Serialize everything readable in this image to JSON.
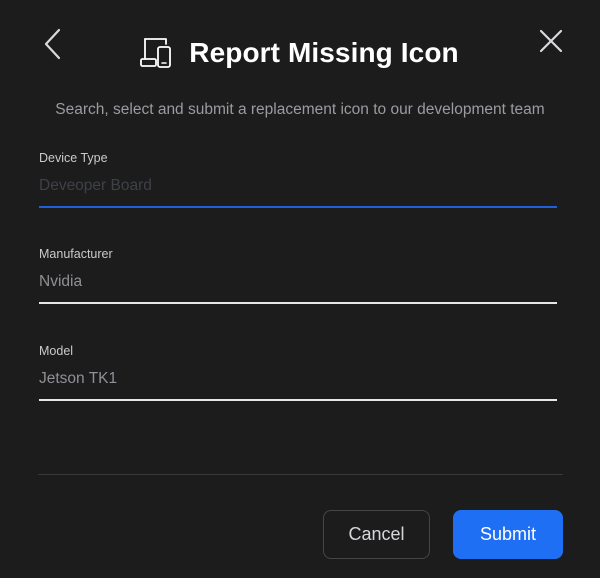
{
  "dialog": {
    "title": "Report Missing Icon",
    "subtitle": "Search, select and submit a replacement icon to our development team",
    "header_icon": "device-type-icon",
    "back_icon": "chevron-left-icon",
    "close_icon": "close-icon"
  },
  "fields": {
    "device_type": {
      "label": "Device Type",
      "placeholder": "Deveoper Board",
      "value": ""
    },
    "manufacturer": {
      "label": "Manufacturer",
      "value": "Nvidia"
    },
    "model": {
      "label": "Model",
      "value": "Jetson TK1"
    }
  },
  "buttons": {
    "cancel_label": "Cancel",
    "submit_label": "Submit"
  },
  "colors": {
    "background": "#1c1c1d",
    "accent": "#1f6ff5",
    "active_underline": "#1f5fd9",
    "text_primary": "#ffffff",
    "text_secondary": "#9a9ca1"
  }
}
